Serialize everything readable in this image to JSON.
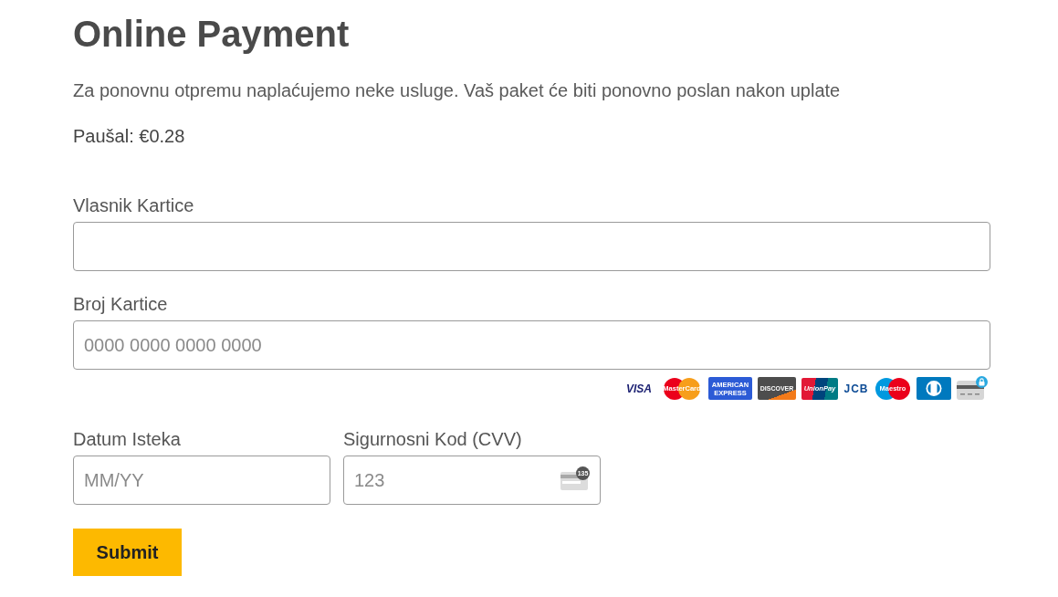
{
  "title": "Online Payment",
  "description": "Za ponovnu otpremu naplaćujemo neke usluge. Vaš paket će biti ponovno poslan nakon uplate",
  "fee": "Paušal: €0.28",
  "fields": [
    {
      "label": "Vlasnik Kartice"
    },
    {
      "label": "Broj Kartice",
      "placeholder": "0000 0000 0000 0000"
    }
  ],
  "card_logos": [
    {
      "kind": "visa",
      "label": "VISA"
    },
    {
      "kind": "mastercard",
      "label": "MasterCard"
    },
    {
      "kind": "amex",
      "label": "AMERICAN EXPRESS"
    },
    {
      "kind": "discover",
      "label": "DISCOVER"
    },
    {
      "kind": "unionpay",
      "label": "UnionPay"
    },
    {
      "kind": "jcb",
      "label": "JCB"
    },
    {
      "kind": "maestro",
      "label": "Maestro"
    },
    {
      "kind": "diners"
    },
    {
      "kind": "secure"
    }
  ],
  "short_fields": [
    {
      "label": "Datum Isteka",
      "placeholder": "MM/YY"
    },
    {
      "label": "Sigurnosni Kod (CVV)",
      "placeholder": "123",
      "badge": "135"
    }
  ],
  "submit": "Submit"
}
